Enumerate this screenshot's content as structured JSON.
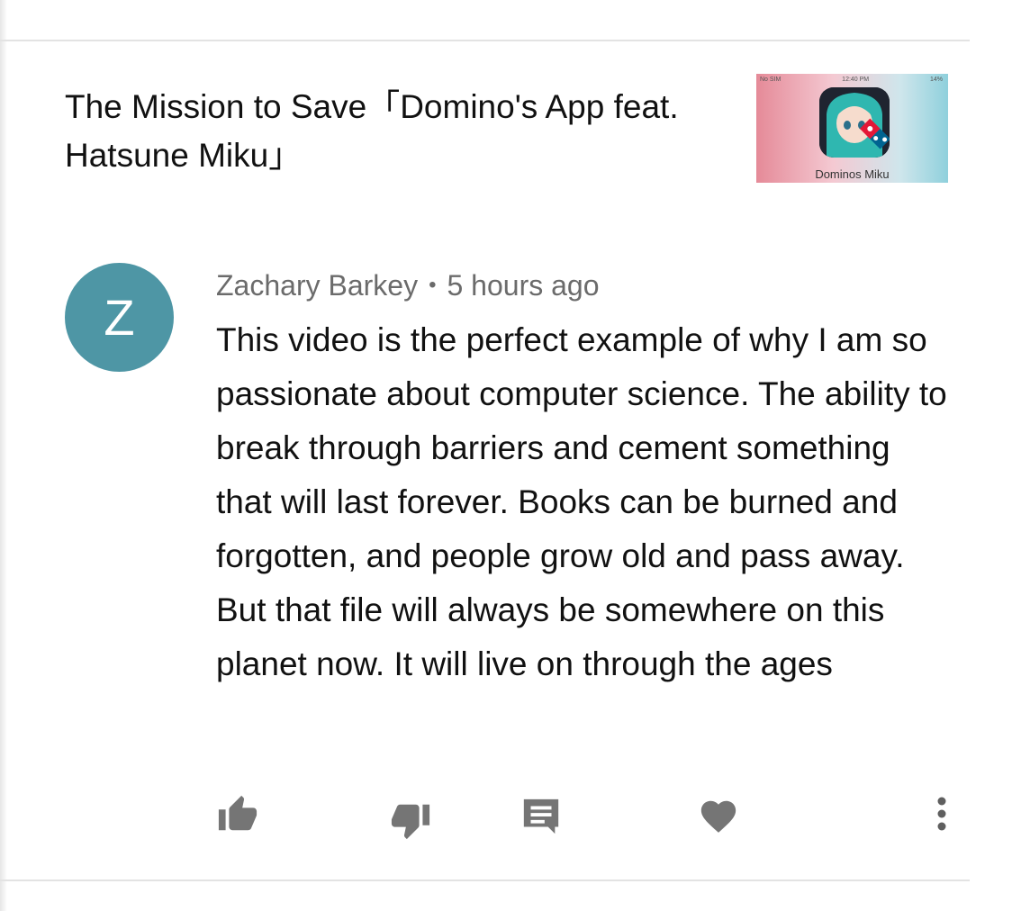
{
  "video": {
    "title": "The Mission to Save「Domino's App feat. Hatsune Miku」",
    "thumbnail_caption": "Dominos Miku",
    "thumbnail_status": {
      "carrier": "No SIM",
      "time": "12:40 PM",
      "battery": "14%"
    }
  },
  "comment": {
    "avatar_letter": "Z",
    "avatar_color": "#4e96a5",
    "author": "Zachary Barkey",
    "separator": "•",
    "time_ago": "5 hours ago",
    "text": "This video is the perfect example of why I am so passionate about computer science. The ability to break through barriers and cement something that will last forever. Books can be burned and forgotten, and people grow old and pass away. But that file will always be somewhere on this planet now. It will live on through the ages"
  },
  "actions": {
    "like_icon": "thumb-up-icon",
    "dislike_icon": "thumb-down-icon",
    "reply_icon": "reply-icon",
    "heart_icon": "heart-icon",
    "more_icon": "more-vert-icon"
  }
}
